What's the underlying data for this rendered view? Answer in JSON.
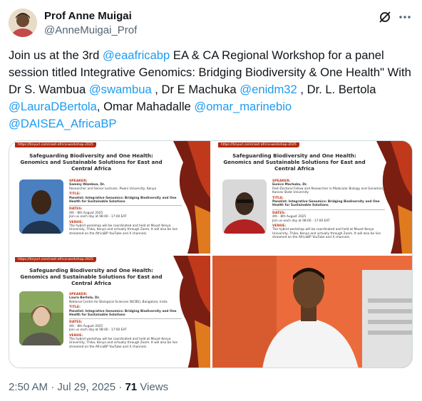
{
  "author": {
    "name": "Prof Anne Muigai",
    "handle": "@AnneMuigai_Prof",
    "avatar_icon": "profile-photo"
  },
  "tweet": {
    "line1_pre": "Join us at the 3rd ",
    "mention_eaafricabp": "@eaafricabp",
    "line1_post": "  EA & CA Regional Workshop for a panel session titled Integrative Genomics: Bridging Biodiversity & One Health\" With Dr S. Wambua ",
    "mention_swambua": "@swambua",
    "sep1": " , Dr E Machuka ",
    "mention_enidm32": "@enidm32",
    "sep2": " , Dr. L. Bertola ",
    "mention_laura": "@LauraDBertola",
    "sep3": ", Omar Mahadalle ",
    "mention_omar": "@omar_marinebio",
    "mention_daisea": "@DAISEA_AfricaBP"
  },
  "cards": [
    {
      "url": "https://tinyurl.com/ceet-africa-workshop-2025",
      "title": "Safeguarding Biodiversity and One Health: Genomics and Sustainable Solutions for East and Central Africa",
      "speaker_label": "SPEAKER:",
      "speaker_name": "Sammy Wambua, Dr.",
      "speaker_role": "Researcher and Senior Lecturer, Pwani University, Kenya",
      "title_label": "TITLE:",
      "talk": "Panelist: Integrative Genomics: Bridging Biodiversity and One Health for Sustainable Solutions",
      "dates_label": "DATES:",
      "dates": "4th - 8th August 2025",
      "time": "Join us each day at 08:00 - 17:00 EAT",
      "venue_label": "VENUE:",
      "venue": "The hybrid workshop will be coordinated and held at Mount Kenya University, Thika, Kenya and virtually through Zoom. It will also be live streamed on the AfricaBP YouTube and X channels."
    },
    {
      "url": "https://tinyurl.com/ceet-africa-workshop-2025",
      "title": "Safeguarding Biodiversity and One Health: Genomics and Sustainable Solutions for East and Central Africa",
      "speaker_label": "SPEAKER:",
      "speaker_name": "Eunice Machuka, Dr.",
      "speaker_role": "Post-Doctoral Fellow and Researcher in Molecular Biology and Genomics, Kansas State University",
      "title_label": "TITLE:",
      "talk": "Panelist: Integrative Genomics: Bridging Biodiversity and One Health for Sustainable Solutions",
      "dates_label": "DATES:",
      "dates": "4th - 8th August 2025",
      "time": "Join us each day at 08:00 - 17:00 EAT",
      "venue_label": "VENUE:",
      "venue": "The hybrid workshop will be coordinated and held at Mount Kenya University, Thika, Kenya and virtually through Zoom. It will also be live streamed on the AfricaBP YouTube and X channels."
    },
    {
      "url": "https://tinyurl.com/ceet-africa-workshop-2025",
      "title": "Safeguarding Biodiversity and One Health: Genomics and Sustainable Solutions for East and Central Africa",
      "speaker_label": "SPEAKER:",
      "speaker_name": "Laura Bertola, Dr.",
      "speaker_role": "National Centre for Biological Sciences (NCBS), Bangalore, India",
      "title_label": "TITLE:",
      "talk": "Panelist: Integrative Genomics: Bridging Biodiversity and One Health for Sustainable Solutions",
      "dates_label": "DATES:",
      "dates": "4th - 8th August 2025",
      "time": "Join us each day at 08:00 - 17:00 EAT",
      "venue_label": "VENUE:",
      "venue": "The hybrid workshop will be coordinated and held at Mount Kenya University, Thika, Kenya and virtually through Zoom. It will also be live streamed on the AfricaBP YouTube and X channels."
    }
  ],
  "meta": {
    "time": "2:50 AM",
    "dot": " · ",
    "date": "Jul 29, 2025",
    "views_count": "71",
    "views_label": " Views"
  },
  "colors": {
    "mention": "#1d9bf0",
    "secondary_text": "#536471",
    "accent_red": "#c0391b"
  },
  "icons": [
    "grok-icon",
    "more-icon"
  ]
}
